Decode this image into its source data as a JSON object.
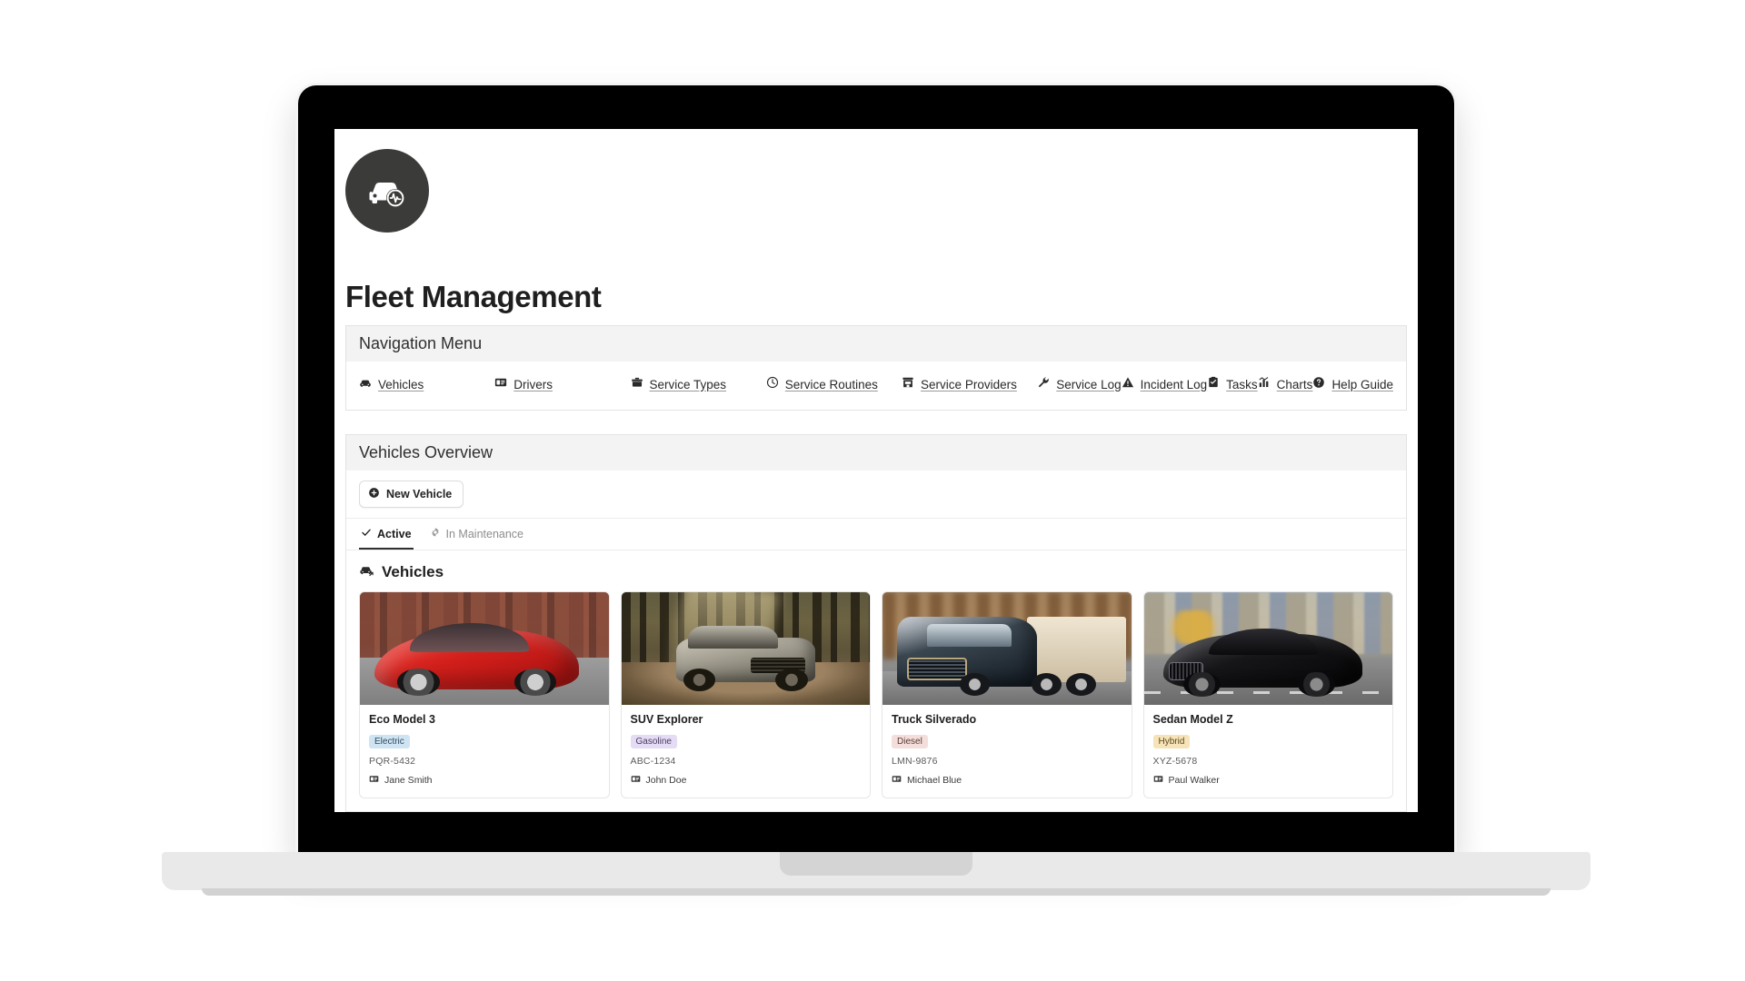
{
  "app": {
    "title": "Fleet Management",
    "logo_icon": "car-pulse-icon"
  },
  "nav_panel": {
    "heading": "Navigation Menu",
    "items": [
      {
        "label": "Vehicles",
        "icon": "car-icon"
      },
      {
        "label": "Drivers",
        "icon": "id-card-icon"
      },
      {
        "label": "Service Types",
        "icon": "toolbox-icon"
      },
      {
        "label": "Service Routines",
        "icon": "clock-icon"
      },
      {
        "label": "Service Providers",
        "icon": "building-store-icon"
      },
      {
        "label": "Service Log",
        "icon": "wrench-icon"
      },
      {
        "label": "Incident Log",
        "icon": "warning-triangle-icon"
      },
      {
        "label": "Tasks",
        "icon": "clipboard-task-icon"
      },
      {
        "label": "Charts",
        "icon": "bar-chart-icon"
      },
      {
        "label": "Help Guide",
        "icon": "question-circle-icon"
      }
    ]
  },
  "overview_panel": {
    "heading": "Vehicles Overview",
    "new_vehicle_label": "New Vehicle",
    "new_vehicle_icon": "plus-circle-icon",
    "tabs": [
      {
        "label": "Active",
        "icon": "check-icon",
        "active": true
      },
      {
        "label": "In Maintenance",
        "icon": "gear-icon",
        "active": false
      }
    ],
    "section_title": "Vehicles",
    "section_icon": "car-arrow-icon",
    "driver_icon": "id-card-icon",
    "vehicles": [
      {
        "name": "Eco Model 3",
        "fuel": "Electric",
        "badge_bg": "#cfe4f3",
        "badge_fg": "#2f4a5c",
        "plate": "PQR-5432",
        "driver": "Jane Smith",
        "photo": "red-sedan-city"
      },
      {
        "name": "SUV Explorer",
        "fuel": "Gasoline",
        "badge_bg": "#e4dbf4",
        "badge_fg": "#4a3d63",
        "plate": "ABC-1234",
        "driver": "John Doe",
        "photo": "suv-forest"
      },
      {
        "name": "Truck Silverado",
        "fuel": "Diesel",
        "badge_bg": "#f3dedb",
        "badge_fg": "#5e3b37",
        "plate": "LMN-9876",
        "driver": "Michael Blue",
        "photo": "semi-truck-highway"
      },
      {
        "name": "Sedan Model Z",
        "fuel": "Hybrid",
        "badge_bg": "#f6e3b8",
        "badge_fg": "#5c4a1e",
        "plate": "XYZ-5678",
        "driver": "Paul Walker",
        "photo": "black-sedan-city"
      }
    ]
  }
}
